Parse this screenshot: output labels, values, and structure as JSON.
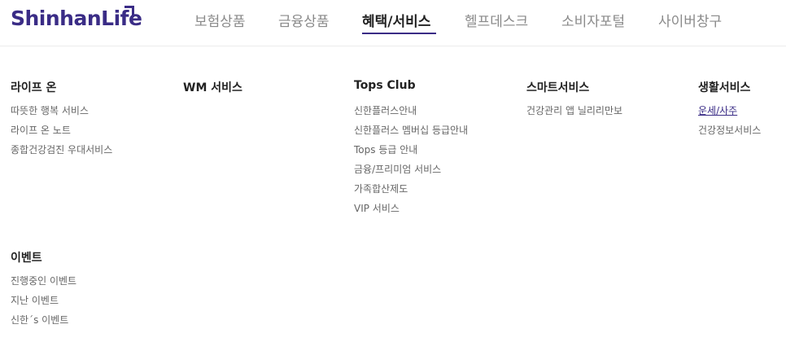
{
  "header": {
    "logo_text": "ShinhanLife",
    "nav": [
      {
        "label": "보험상품"
      },
      {
        "label": "금융상품"
      },
      {
        "label": "혜택/서비스"
      },
      {
        "label": "헬프데스크"
      },
      {
        "label": "소비자포털"
      },
      {
        "label": "사이버창구"
      }
    ]
  },
  "menu": {
    "columns": [
      {
        "title": "라이프 온",
        "items": [
          "따뜻한 행복 서비스",
          "라이프 온 노트",
          "종합건강검진 우대서비스"
        ]
      },
      {
        "title": "WM 서비스",
        "items": []
      },
      {
        "title": "Tops Club",
        "items": [
          "신한플러스안내",
          "신한플러스 멤버십 등급안내",
          "Tops 등급 안내",
          "금융/프리미엄 서비스",
          "가족합산제도",
          "VIP 서비스"
        ]
      },
      {
        "title": "스마트서비스",
        "items": [
          "건강관리 앱 닐리리만보"
        ]
      },
      {
        "title": "생활서비스",
        "items": [
          "운세/사주",
          "건강정보서비스"
        ]
      },
      {
        "title": "이벤트",
        "items": [
          "진행중인 이벤트",
          "지난 이벤트",
          "신한´s 이벤트"
        ]
      }
    ]
  }
}
